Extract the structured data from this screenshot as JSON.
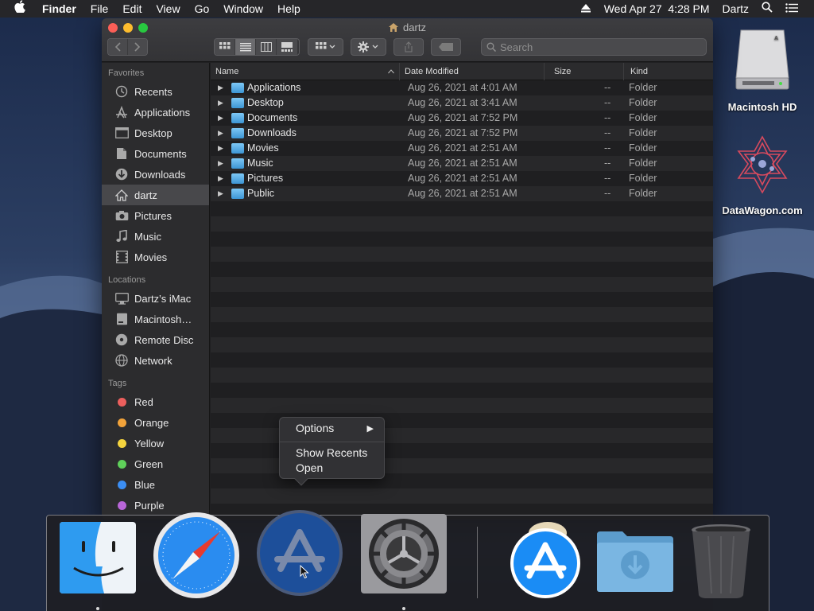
{
  "menubar": {
    "app_name": "Finder",
    "menus": [
      "File",
      "Edit",
      "View",
      "Go",
      "Window",
      "Help"
    ],
    "clock": "Wed Apr 27  4:28 PM",
    "user": "Dartz"
  },
  "desktop_icons": [
    {
      "label": "Macintosh HD",
      "icon": "hard-drive-icon"
    },
    {
      "label": "DataWagon.com",
      "icon": "datawagon-logo-icon"
    }
  ],
  "window": {
    "title": "dartz",
    "search_placeholder": "Search",
    "sidebar": {
      "favorites_header": "Favorites",
      "favorites": [
        {
          "label": "Recents",
          "icon": "clock-icon"
        },
        {
          "label": "Applications",
          "icon": "applications-icon"
        },
        {
          "label": "Desktop",
          "icon": "desktop-icon"
        },
        {
          "label": "Documents",
          "icon": "document-icon"
        },
        {
          "label": "Downloads",
          "icon": "download-icon"
        },
        {
          "label": "dartz",
          "icon": "home-icon",
          "selected": true
        },
        {
          "label": "Pictures",
          "icon": "camera-icon"
        },
        {
          "label": "Music",
          "icon": "music-note-icon"
        },
        {
          "label": "Movies",
          "icon": "film-icon"
        }
      ],
      "locations_header": "Locations",
      "locations": [
        {
          "label": "Dartz’s iMac",
          "icon": "imac-icon"
        },
        {
          "label": "Macintosh…",
          "icon": "disk-icon"
        },
        {
          "label": "Remote Disc",
          "icon": "disc-icon"
        },
        {
          "label": "Network",
          "icon": "globe-icon"
        }
      ],
      "tags_header": "Tags",
      "tags": [
        {
          "label": "Red",
          "color": "#ec5f5d"
        },
        {
          "label": "Orange",
          "color": "#f2a33a"
        },
        {
          "label": "Yellow",
          "color": "#f5d43e"
        },
        {
          "label": "Green",
          "color": "#5fd05a"
        },
        {
          "label": "Blue",
          "color": "#3b8ef3"
        },
        {
          "label": "Purple",
          "color": "#b966d8"
        }
      ]
    },
    "columns": {
      "name": "Name",
      "date": "Date Modified",
      "size": "Size",
      "kind": "Kind"
    },
    "files": [
      {
        "name": "Applications",
        "date": "Aug 26, 2021 at 4:01 AM",
        "size": "--",
        "kind": "Folder"
      },
      {
        "name": "Desktop",
        "date": "Aug 26, 2021 at 3:41 AM",
        "size": "--",
        "kind": "Folder"
      },
      {
        "name": "Documents",
        "date": "Aug 26, 2021 at 7:52 PM",
        "size": "--",
        "kind": "Folder"
      },
      {
        "name": "Downloads",
        "date": "Aug 26, 2021 at 7:52 PM",
        "size": "--",
        "kind": "Folder"
      },
      {
        "name": "Movies",
        "date": "Aug 26, 2021 at 2:51 AM",
        "size": "--",
        "kind": "Folder"
      },
      {
        "name": "Music",
        "date": "Aug 26, 2021 at 2:51 AM",
        "size": "--",
        "kind": "Folder"
      },
      {
        "name": "Pictures",
        "date": "Aug 26, 2021 at 2:51 AM",
        "size": "--",
        "kind": "Folder"
      },
      {
        "name": "Public",
        "date": "Aug 26, 2021 at 2:51 AM",
        "size": "--",
        "kind": "Folder"
      }
    ]
  },
  "context_menu": {
    "options": "Options",
    "show_recents": "Show Recents",
    "open": "Open"
  },
  "dock": [
    {
      "icon": "finder-icon",
      "running": true
    },
    {
      "icon": "safari-icon",
      "running": false
    },
    {
      "icon": "app-store-icon",
      "running": false
    },
    {
      "icon": "system-preferences-icon",
      "running": true
    },
    {
      "icon": "app-store-icon",
      "running": false
    },
    {
      "icon": "downloads-stack-icon",
      "running": false
    },
    {
      "icon": "trash-icon",
      "running": false
    }
  ]
}
